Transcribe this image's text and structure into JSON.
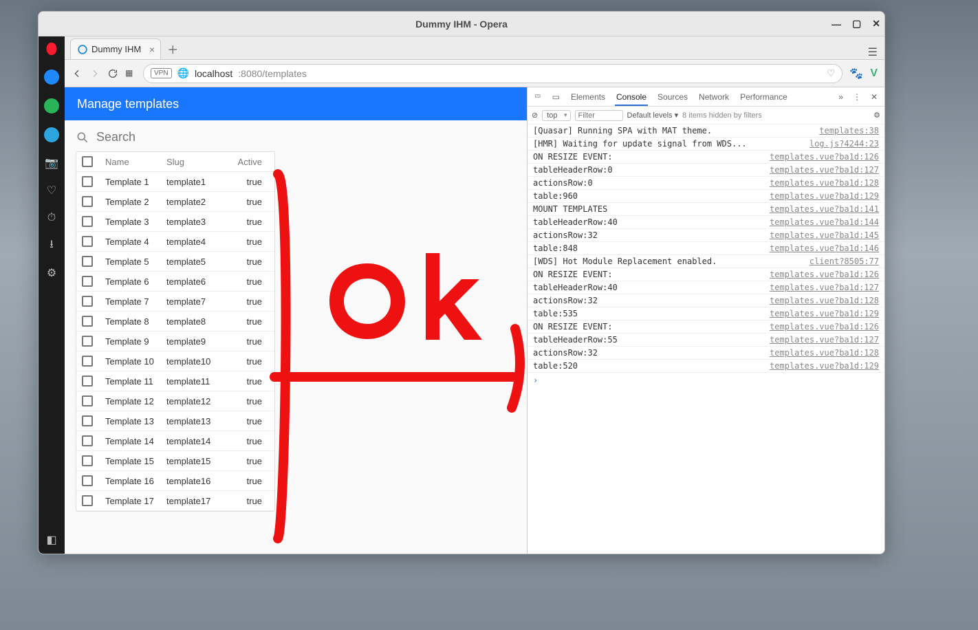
{
  "window": {
    "title": "Dummy IHM - Opera"
  },
  "tab": {
    "title": "Dummy IHM"
  },
  "url": {
    "host": "localhost",
    "rest": ":8080/templates"
  },
  "page": {
    "title": "Manage templates",
    "search_placeholder": "Search"
  },
  "table": {
    "headers": {
      "name": "Name",
      "slug": "Slug",
      "active": "Active"
    },
    "rows": [
      {
        "name": "Template 1",
        "slug": "template1",
        "active": "true"
      },
      {
        "name": "Template 2",
        "slug": "template2",
        "active": "true"
      },
      {
        "name": "Template 3",
        "slug": "template3",
        "active": "true"
      },
      {
        "name": "Template 4",
        "slug": "template4",
        "active": "true"
      },
      {
        "name": "Template 5",
        "slug": "template5",
        "active": "true"
      },
      {
        "name": "Template 6",
        "slug": "template6",
        "active": "true"
      },
      {
        "name": "Template 7",
        "slug": "template7",
        "active": "true"
      },
      {
        "name": "Template 8",
        "slug": "template8",
        "active": "true"
      },
      {
        "name": "Template 9",
        "slug": "template9",
        "active": "true"
      },
      {
        "name": "Template 10",
        "slug": "template10",
        "active": "true"
      },
      {
        "name": "Template 11",
        "slug": "template11",
        "active": "true"
      },
      {
        "name": "Template 12",
        "slug": "template12",
        "active": "true"
      },
      {
        "name": "Template 13",
        "slug": "template13",
        "active": "true"
      },
      {
        "name": "Template 14",
        "slug": "template14",
        "active": "true"
      },
      {
        "name": "Template 15",
        "slug": "template15",
        "active": "true"
      },
      {
        "name": "Template 16",
        "slug": "template16",
        "active": "true"
      },
      {
        "name": "Template 17",
        "slug": "template17",
        "active": "true"
      }
    ]
  },
  "annotation": {
    "text": "Ok"
  },
  "devtools": {
    "tabs": {
      "elements": "Elements",
      "console": "Console",
      "sources": "Sources",
      "network": "Network",
      "performance": "Performance"
    },
    "filter": {
      "scope": "top",
      "placeholder": "Filter",
      "levels": "Default levels ▾",
      "hidden": "8 items hidden by filters"
    },
    "logs": [
      {
        "msg": "[Quasar] Running SPA with MAT theme.",
        "src": "templates:38"
      },
      {
        "msg": "[HMR] Waiting for update signal from WDS...",
        "src": "log.js?4244:23"
      },
      {
        "msg": "ON RESIZE EVENT:",
        "src": "templates.vue?ba1d:126"
      },
      {
        "msg": "tableHeaderRow:0",
        "src": "templates.vue?ba1d:127"
      },
      {
        "msg": "actionsRow:0",
        "src": "templates.vue?ba1d:128"
      },
      {
        "msg": "table:960",
        "src": "templates.vue?ba1d:129"
      },
      {
        "msg": "MOUNT TEMPLATES",
        "src": "templates.vue?ba1d:141"
      },
      {
        "msg": "tableHeaderRow:40",
        "src": "templates.vue?ba1d:144"
      },
      {
        "msg": "actionsRow:32",
        "src": "templates.vue?ba1d:145"
      },
      {
        "msg": "table:848",
        "src": "templates.vue?ba1d:146"
      },
      {
        "msg": "[WDS] Hot Module Replacement enabled.",
        "src": "client?8505:77"
      },
      {
        "msg": "ON RESIZE EVENT:",
        "src": "templates.vue?ba1d:126"
      },
      {
        "msg": "tableHeaderRow:40",
        "src": "templates.vue?ba1d:127"
      },
      {
        "msg": "actionsRow:32",
        "src": "templates.vue?ba1d:128"
      },
      {
        "msg": "table:535",
        "src": "templates.vue?ba1d:129"
      },
      {
        "msg": "ON RESIZE EVENT:",
        "src": "templates.vue?ba1d:126"
      },
      {
        "msg": "tableHeaderRow:55",
        "src": "templates.vue?ba1d:127"
      },
      {
        "msg": "actionsRow:32",
        "src": "templates.vue?ba1d:128"
      },
      {
        "msg": "table:520",
        "src": "templates.vue?ba1d:129"
      }
    ]
  }
}
